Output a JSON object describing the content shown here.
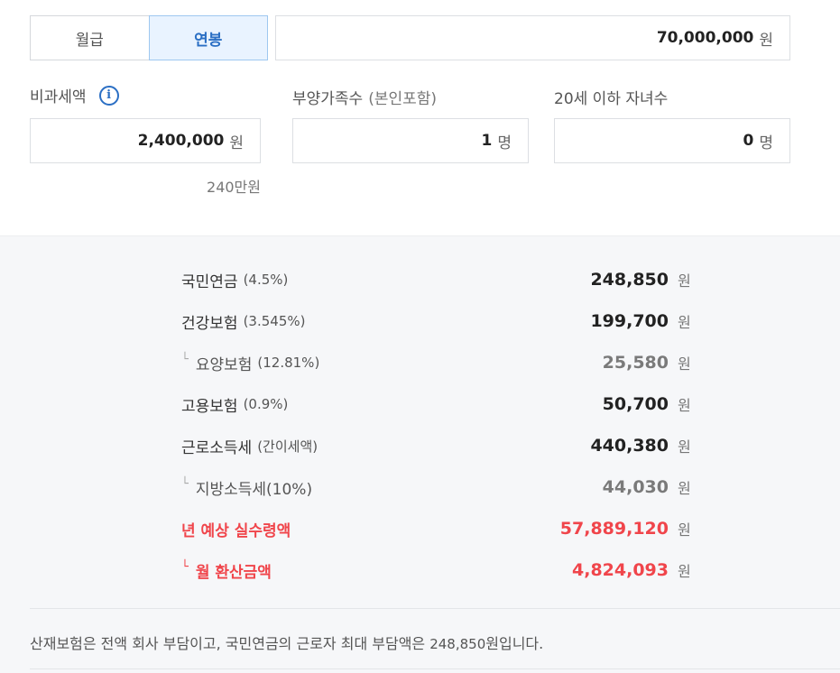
{
  "pay_type": {
    "options": [
      "월급",
      "연봉"
    ],
    "selected": "연봉"
  },
  "salary": {
    "value": "70,000,000",
    "unit": "원"
  },
  "nontax": {
    "label": "비과세액",
    "value": "2,400,000",
    "unit": "원",
    "helper": "240만원"
  },
  "dependents": {
    "label": "부양가족수",
    "sublabel": "(본인포함)",
    "value": "1",
    "unit": "명"
  },
  "children": {
    "label": "20세 이하 자녀수",
    "value": "0",
    "unit": "명"
  },
  "results": [
    {
      "name": "국민연금",
      "rate": "(4.5%)",
      "amount": "248,850",
      "unit": "원",
      "kind": "main"
    },
    {
      "name": "건강보험",
      "rate": "(3.545%)",
      "amount": "199,700",
      "unit": "원",
      "kind": "main"
    },
    {
      "name": "요양보험",
      "rate": "(12.81%)",
      "amount": "25,580",
      "unit": "원",
      "kind": "sub"
    },
    {
      "name": "고용보험",
      "rate": "(0.9%)",
      "amount": "50,700",
      "unit": "원",
      "kind": "main"
    },
    {
      "name": "근로소득세",
      "rate": "(간이세액)",
      "amount": "440,380",
      "unit": "원",
      "kind": "main"
    },
    {
      "name": "지방소득세(10%)",
      "rate": "",
      "amount": "44,030",
      "unit": "원",
      "kind": "sub"
    },
    {
      "name": "년 예상 실수령액",
      "rate": "",
      "amount": "57,889,120",
      "unit": "원",
      "kind": "red"
    },
    {
      "name": "월 환산금액",
      "rate": "",
      "amount": "4,824,093",
      "unit": "원",
      "kind": "red-sub"
    }
  ],
  "note": {
    "before": "산재보험은 전액 회사 부담이고, 국민연금의 근로자 최대 부담액은 ",
    "amount": "248,850",
    "after": "원입니다."
  },
  "icons": {
    "info": "i",
    "branch": "└"
  },
  "colors": {
    "accent": "#2b6fc4",
    "highlight": "#f0454b"
  }
}
